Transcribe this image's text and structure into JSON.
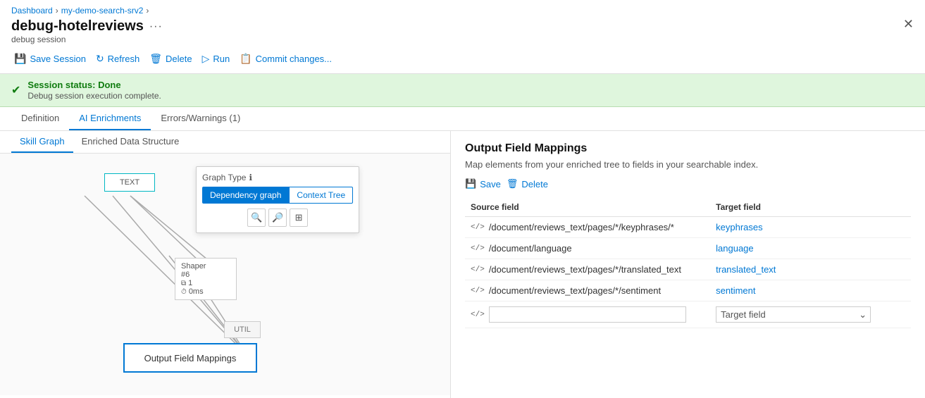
{
  "breadcrumb": {
    "items": [
      "Dashboard",
      "my-demo-search-srv2"
    ]
  },
  "header": {
    "title": "debug-hotelreviews",
    "subtitle": "debug session",
    "dots_label": "···",
    "close_label": "✕"
  },
  "toolbar": {
    "save_label": "Save Session",
    "refresh_label": "Refresh",
    "delete_label": "Delete",
    "run_label": "Run",
    "commit_label": "Commit changes..."
  },
  "status": {
    "title": "Session status: Done",
    "description": "Debug session execution complete."
  },
  "tabs": [
    {
      "label": "Definition",
      "active": false
    },
    {
      "label": "AI Enrichments",
      "active": true
    },
    {
      "label": "Errors/Warnings (1)",
      "active": false
    }
  ],
  "graph_subtabs": [
    {
      "label": "Skill Graph",
      "active": true
    },
    {
      "label": "Enriched Data Structure",
      "active": false
    }
  ],
  "graph_type": {
    "label": "Graph Type",
    "info": "ℹ",
    "options": [
      "Dependency graph",
      "Context Tree"
    ],
    "selected": "Dependency graph"
  },
  "graph_icons": [
    "🔍",
    "🔎",
    "⊞"
  ],
  "nodes": {
    "text_label": "TEXT",
    "shaper_label": "Shaper",
    "shaper_num": "#6",
    "shaper_count": "1",
    "shaper_time": "0ms",
    "util_label": "UTIL",
    "output_label": "Output Field Mappings"
  },
  "output_panel": {
    "title": "Output Field Mappings",
    "description": "Map elements from your enriched tree to fields in your searchable index.",
    "save_label": "Save",
    "delete_label": "Delete",
    "columns": {
      "source": "Source field",
      "target": "Target field"
    },
    "mappings": [
      {
        "source": "/document/reviews_text/pages/*/keyphrases/*",
        "target": "keyphrases"
      },
      {
        "source": "/document/language",
        "target": "language"
      },
      {
        "source": "/document/reviews_text/pages/*/translated_text",
        "target": "translated_text"
      },
      {
        "source": "/document/reviews_text/pages/*/sentiment",
        "target": "sentiment"
      }
    ],
    "new_row": {
      "source_placeholder": "",
      "target_placeholder": "Target field"
    }
  }
}
